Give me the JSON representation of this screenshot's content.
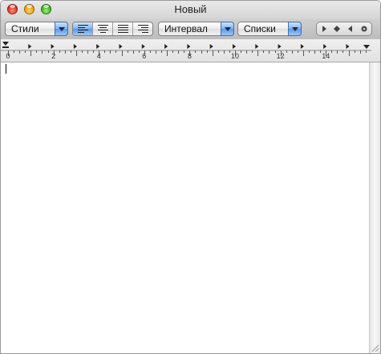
{
  "window": {
    "title": "Новый"
  },
  "toolbar": {
    "styles_popup": {
      "value": "Стили",
      "icon": "chevron-down-icon"
    },
    "alignment": [
      {
        "name": "align-left",
        "icon": "align-left-icon",
        "selected": true
      },
      {
        "name": "align-center",
        "icon": "align-center-icon",
        "selected": false
      },
      {
        "name": "align-justify",
        "icon": "align-justify-icon",
        "selected": false
      },
      {
        "name": "align-right",
        "icon": "align-right-icon",
        "selected": false
      }
    ],
    "spacing_popup": {
      "value": "Интервал",
      "icon": "chevron-down-icon"
    },
    "lists_popup": {
      "value": "Списки",
      "icon": "chevron-down-icon"
    },
    "tab_stops": [
      "left-tab-icon",
      "center-tab-icon",
      "right-tab-icon",
      "decimal-tab-icon"
    ]
  },
  "ruler": {
    "labels": [
      "0",
      "2",
      "4",
      "6",
      "8",
      "10",
      "12",
      "14"
    ]
  },
  "document": {
    "text": ""
  },
  "colors": {
    "accent": "#5a98e4",
    "close": "#d8261a",
    "minimize": "#e49a10",
    "zoom": "#3aa61c"
  }
}
